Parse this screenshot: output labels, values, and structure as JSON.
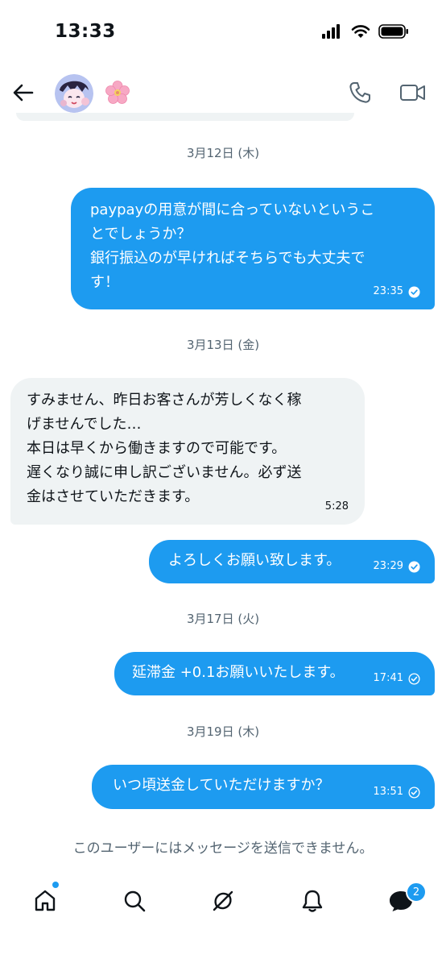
{
  "status_bar": {
    "time": "13:33"
  },
  "header": {
    "name_emoji": "🌸"
  },
  "messages": [
    {
      "date": "3月12日 (木)",
      "direction": "sent",
      "lines": [
        "paypayの用意が間に合っていないというこ",
        "とでしょうか？",
        "銀行振込のが早ければそちらでも大丈夫で",
        "す！"
      ],
      "time": "23:35",
      "status": "read"
    },
    {
      "date": "3月13日 (金)",
      "direction": "received",
      "lines": [
        "すみません、昨日お客さんが芳しくなく稼",
        "げませんでした…",
        "本日は早くから働きますので可能です。",
        "遅くなり誠に申し訳ございません。必ず送",
        "金はさせていただきます。"
      ],
      "time": "5:28"
    },
    {
      "direction": "sent",
      "lines": [
        "よろしくお願い致します。"
      ],
      "time": "23:29",
      "status": "read"
    },
    {
      "date": "3月17日 (火)",
      "direction": "sent",
      "lines": [
        "延滞金 +0.1お願いいたします。"
      ],
      "time": "17:41",
      "status": "sent"
    },
    {
      "date": "3月19日 (木)",
      "direction": "sent",
      "lines": [
        "いつ頃送金していただけますか？"
      ],
      "time": "13:51",
      "status": "sent"
    }
  ],
  "notice": "このユーザーにはメッセージを送信できません。",
  "tabbar": {
    "items": [
      "home-icon",
      "search-icon",
      "grok-icon",
      "bell-icon",
      "messages-icon"
    ],
    "messages_badge": "2"
  },
  "colors": {
    "accent": "#1d9bf0",
    "received_bg": "#eff3f4",
    "secondary_text": "#536471"
  }
}
